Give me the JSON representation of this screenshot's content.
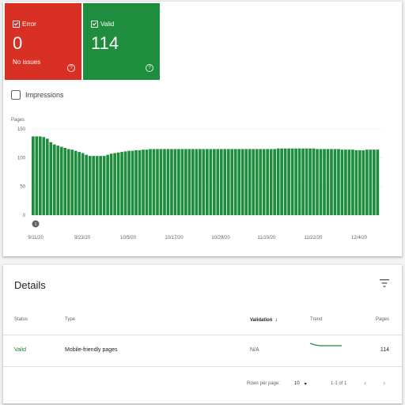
{
  "summary": {
    "error": {
      "label": "Error",
      "count": "0",
      "sub": "No issues",
      "color": "#d93025"
    },
    "valid": {
      "label": "Valid",
      "count": "114",
      "color": "#1e8e3e"
    }
  },
  "impressions_label": "Impressions",
  "chart_data": {
    "type": "bar",
    "ylabel": "Pages",
    "ylim": [
      0,
      150
    ],
    "yticks": [
      "0",
      "50",
      "100",
      "150"
    ],
    "xtick_labels": [
      "9/11/20",
      "9/23/20",
      "10/5/20",
      "10/17/20",
      "10/29/20",
      "11/10/20",
      "11/22/20",
      "12/4/20"
    ],
    "marker": "1",
    "color": "#1e8e3e",
    "values": [
      137,
      137,
      137,
      136,
      133,
      127,
      123,
      121,
      119,
      117,
      115,
      114,
      112,
      110,
      108,
      105,
      103,
      103,
      103,
      103,
      103,
      105,
      107,
      108,
      109,
      110,
      111,
      112,
      112,
      113,
      113,
      114,
      114,
      115,
      115,
      115,
      115,
      115,
      115,
      115,
      115,
      115,
      115,
      115,
      115,
      115,
      115,
      115,
      115,
      115,
      115,
      115,
      115,
      115,
      115,
      115,
      115,
      115,
      115,
      115,
      115,
      115,
      115,
      115,
      115,
      115,
      115,
      115,
      115,
      116,
      116,
      116,
      116,
      116,
      116,
      116,
      116,
      116,
      116,
      116,
      115,
      115,
      115,
      115,
      115,
      115,
      115,
      114,
      114,
      114,
      114,
      113,
      113,
      113,
      114,
      114,
      114,
      114
    ]
  },
  "details": {
    "title": "Details",
    "columns": {
      "status": "Status",
      "type": "Type",
      "validation": "Validation",
      "trend": "Trend",
      "pages": "Pages"
    },
    "row": {
      "status": "Valid",
      "type": "Mobile-friendly pages",
      "validation": "N/A",
      "pages": "114"
    },
    "pagination": {
      "rows_label": "Rows per page:",
      "rows_value": "10",
      "range": "1-1 of 1"
    }
  }
}
